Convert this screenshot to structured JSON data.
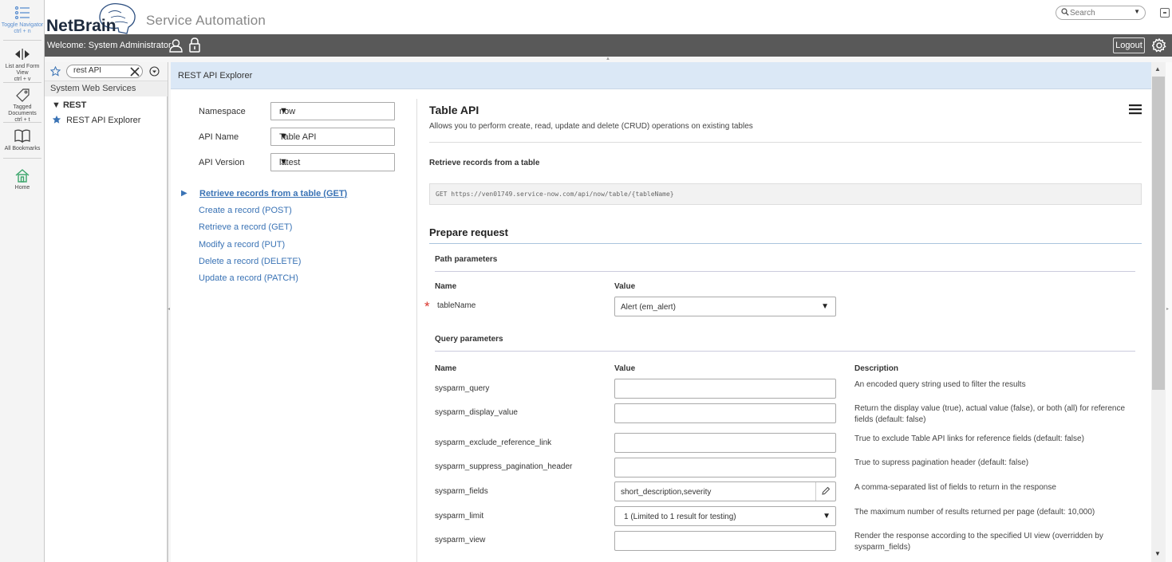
{
  "rail": {
    "toggle_navigator": {
      "label": "Toggle Navigator",
      "shortcut": "ctrl + n"
    },
    "list_form_view": {
      "label": "List and Form View",
      "shortcut": "ctrl + v"
    },
    "tagged_documents": {
      "label": "Tagged Documents",
      "shortcut": "ctrl + t"
    },
    "all_bookmarks": {
      "label": "All Bookmarks"
    },
    "home": {
      "label": "Home"
    }
  },
  "header": {
    "logo_text": "NetBrain",
    "app_title": "Service Automation",
    "search_placeholder": "Search",
    "welcome": "Welcome:  System Administrator",
    "logout_label": "Logout"
  },
  "navigator": {
    "filter_value": "rest API",
    "section_title": "System Web Services",
    "group_label": "REST",
    "item_label": "REST API Explorer"
  },
  "content": {
    "header_title": "REST API Explorer",
    "form": {
      "namespace_label": "Namespace",
      "namespace_value": "now",
      "api_name_label": "API Name",
      "api_name_value": "Table API",
      "api_version_label": "API Version",
      "api_version_value": "latest"
    },
    "methods": [
      {
        "label": "Retrieve records from a table  (GET)",
        "active": true
      },
      {
        "label": "Create a record  (POST)"
      },
      {
        "label": "Retrieve a record  (GET)"
      },
      {
        "label": "Modify a record  (PUT)"
      },
      {
        "label": "Delete a record  (DELETE)"
      },
      {
        "label": "Update a record  (PATCH)"
      }
    ],
    "api_title": "Table API",
    "api_description": "Allows you to perform create, read, update and delete (CRUD) operations on existing tables",
    "operation_title": "Retrieve records from a table",
    "request_url": "GET https://ven01749.service-now.com/api/now/table/{tableName}",
    "prepare_title": "Prepare request",
    "path_params": {
      "title": "Path parameters",
      "col_name": "Name",
      "col_value": "Value",
      "required_mark": "*",
      "name": "tableName",
      "value": "Alert (em_alert)"
    },
    "query_params": {
      "title": "Query parameters",
      "col_name": "Name",
      "col_value": "Value",
      "col_desc": "Description",
      "rows": [
        {
          "name": "sysparm_query",
          "value": "",
          "desc": "An encoded query string used to filter the results"
        },
        {
          "name": "sysparm_display_value",
          "value": "",
          "desc": "Return the display value (true), actual value (false), or both (all) for reference fields (default: false)"
        },
        {
          "name": "sysparm_exclude_reference_link",
          "value": "",
          "desc": "True to exclude Table API links for reference fields (default: false)"
        },
        {
          "name": "sysparm_suppress_pagination_header",
          "value": "",
          "desc": "True to supress pagination header (default: false)"
        },
        {
          "name": "sysparm_fields",
          "value": "short_description,severity",
          "desc": "A comma-separated list of fields to return in the response"
        },
        {
          "name": "sysparm_limit",
          "value": "1 (Limited to 1 result for testing)",
          "desc": "The maximum number of results returned per page (default: 10,000)"
        },
        {
          "name": "sysparm_view",
          "value": "",
          "desc": "Render the response according to the specified UI view (overridden by sysparm_fields)"
        }
      ]
    }
  },
  "colors": {
    "link": "#3a73b5",
    "header_bar": "#595959",
    "content_header": "#dbe8f6",
    "required": "#d9342b"
  }
}
